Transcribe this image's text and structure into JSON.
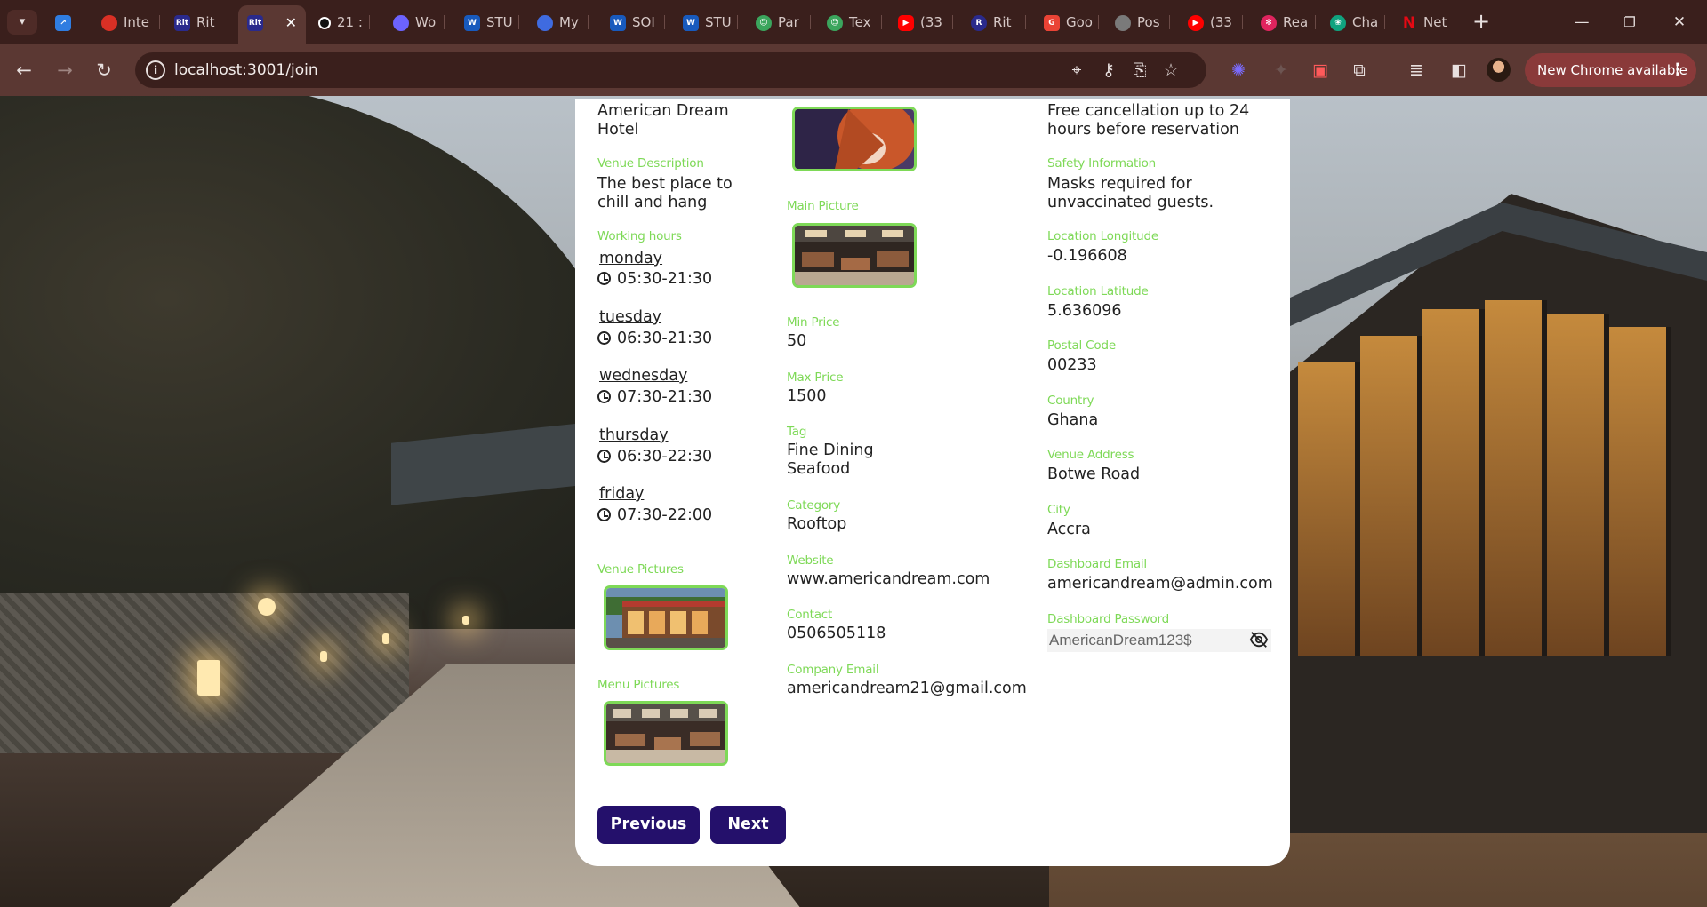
{
  "browser": {
    "tabs": [
      {
        "label": "",
        "icon": "cursor-logo-icon",
        "color": "#2f7de1"
      },
      {
        "label": "Inte",
        "icon": "red-ring-icon",
        "color": "#d93025"
      },
      {
        "label": "Rit",
        "icon": "rit-logo-icon",
        "color": "#2a2a8c"
      },
      {
        "label": "Rit",
        "icon": "rit-logo-icon",
        "color": "#2a2a8c",
        "active": true
      },
      {
        "label": "21 :",
        "icon": "spinner-icon",
        "color": "#111111"
      },
      {
        "label": "Wo",
        "icon": "circle-logo-icon",
        "color": "#6c63ff"
      },
      {
        "label": "STU",
        "icon": "word-icon",
        "color": "#185abd"
      },
      {
        "label": "My",
        "icon": "circle-logo-icon",
        "color": "#3f6be0"
      },
      {
        "label": "SOI",
        "icon": "word-icon",
        "color": "#185abd"
      },
      {
        "label": "STU",
        "icon": "word-icon",
        "color": "#185abd"
      },
      {
        "label": "Par",
        "icon": "robot-icon",
        "color": "#3ba55d"
      },
      {
        "label": "Tex",
        "icon": "robot-icon",
        "color": "#3ba55d"
      },
      {
        "label": "(33",
        "icon": "youtube-icon",
        "color": "#ff0000"
      },
      {
        "label": "Rit",
        "icon": "rit-logo-icon",
        "color": "#2a2a8c"
      },
      {
        "label": "Goo",
        "icon": "google-icon",
        "color": "#ea4335"
      },
      {
        "label": "Pos",
        "icon": "circle-logo-icon",
        "color": "#7a7a7a"
      },
      {
        "label": "(33",
        "icon": "youtube-icon",
        "color": "#ff0000"
      },
      {
        "label": "Rea",
        "icon": "react-icon",
        "color": "#e0245e"
      },
      {
        "label": "Cha",
        "icon": "chatgpt-icon",
        "color": "#10a37f"
      },
      {
        "label": "Net",
        "icon": "netflix-icon",
        "color": "#e50914"
      }
    ],
    "active_tab_fav_text": "Rit",
    "url": "localhost:3001/join",
    "update_label": "New Chrome available"
  },
  "form": {
    "col1": {
      "venue_name": "American Dream Hotel",
      "description_label": "Venue Description",
      "description": "The best place to chill and hang",
      "working_hours_label": "Working hours",
      "working_hours": [
        {
          "day": "monday",
          "hours": "05:30-21:30"
        },
        {
          "day": "tuesday",
          "hours": "06:30-21:30"
        },
        {
          "day": "wednesday",
          "hours": "07:30-21:30"
        },
        {
          "day": "thursday",
          "hours": "06:30-22:30"
        },
        {
          "day": "friday",
          "hours": "07:30-22:00"
        }
      ],
      "venue_pictures_label": "Venue Pictures",
      "menu_pictures_label": "Menu Pictures"
    },
    "col2": {
      "main_picture_label": "Main Picture",
      "min_price_label": "Min Price",
      "min_price": "50",
      "max_price_label": "Max Price",
      "max_price": "1500",
      "tag_label": "Tag",
      "tags": [
        "Fine Dining",
        "Seafood"
      ],
      "category_label": "Category",
      "category": "Rooftop",
      "website_label": "Website",
      "website": "www.americandream.com",
      "contact_label": "Contact",
      "contact": "0506505118",
      "company_email_label": "Company Email",
      "company_email": "americandream21@gmail.com"
    },
    "col3": {
      "cancellation": "Free cancellation up to 24 hours before reservation",
      "safety_label": "Safety Information",
      "safety": "Masks required for unvaccinated guests.",
      "longitude_label": "Location Longitude",
      "longitude": "-0.196608",
      "latitude_label": "Location Latitude",
      "latitude": "5.636096",
      "postal_label": "Postal Code",
      "postal": "00233",
      "country_label": "Country",
      "country": "Ghana",
      "address_label": "Venue Address",
      "address": "Botwe Road",
      "city_label": "City",
      "city": "Accra",
      "dashboard_email_label": "Dashboard Email",
      "dashboard_email": "americandream@admin.com",
      "dashboard_password_label": "Dashboard Password",
      "dashboard_password": "AmericanDream123$"
    },
    "buttons": {
      "previous": "Previous",
      "next": "Next"
    }
  },
  "colors": {
    "label_green": "#7ed957",
    "button_navy": "#24106b",
    "chrome_frame": "#3a1f1c",
    "chrome_toolbar": "#5b3833"
  }
}
